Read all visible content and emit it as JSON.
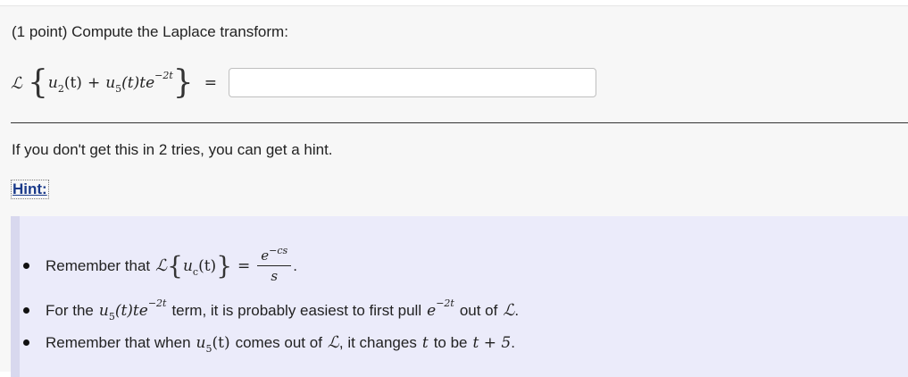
{
  "problem": {
    "title": "(1 point) Compute the Laplace transform:",
    "equation": {
      "operator": "ℒ",
      "open_brace": "{",
      "close_brace": "}",
      "term1_base": "u",
      "term1_sub": "2",
      "term1_arg": "(t)",
      "plus": "+",
      "term2_base": "u",
      "term2_sub": "5",
      "term2_arg": "(t)te",
      "term2_exp": "−2t",
      "equals": "="
    },
    "answer": {
      "value": "",
      "placeholder": ""
    }
  },
  "hint_notice": "If you don't get this in 2 tries, you can get a hint.",
  "hint_link": "Hint:",
  "hints": {
    "b1_text": "Remember that",
    "b1_op": "ℒ",
    "b1_open": "{",
    "b1_u": "u",
    "b1_sub": "c",
    "b1_arg": "(t)",
    "b1_close": "}",
    "b1_eq": "=",
    "b1_num_base": "e",
    "b1_num_exp": "−cs",
    "b1_den": "s",
    "b1_end": ".",
    "b2_text1": "For the",
    "b2_u": "u",
    "b2_sub": "5",
    "b2_arg": "(t)te",
    "b2_exp": "−2t",
    "b2_text2": "term, it is probably easiest to first pull",
    "b2_e": "e",
    "b2_e_exp": "−2t",
    "b2_text3": "out of",
    "b2_op": "ℒ",
    "b2_end": ".",
    "b3_text1": "Remember that when",
    "b3_u": "u",
    "b3_sub": "5",
    "b3_arg": "(t)",
    "b3_text2": "comes out of",
    "b3_op": "ℒ",
    "b3_text3": ", it changes",
    "b3_t": "t",
    "b3_text4": "to be",
    "b3_expr": "t + 5",
    "b3_end": "."
  }
}
